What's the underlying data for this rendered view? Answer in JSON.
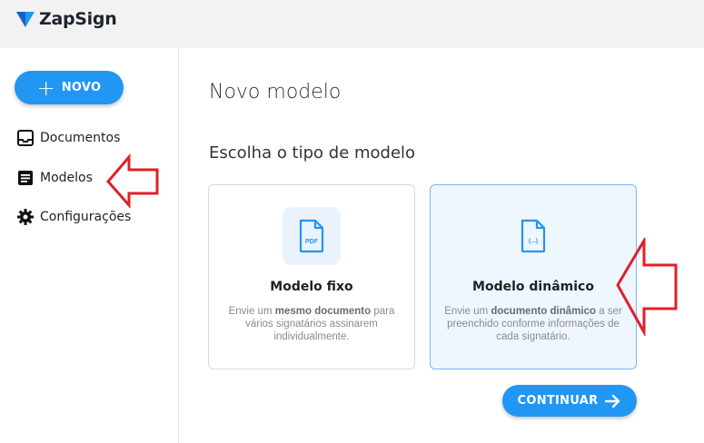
{
  "brand": {
    "name": "ZapSign",
    "accent": "#2196f3"
  },
  "sidebar": {
    "new_button": {
      "icon": "plus-icon",
      "label": "NOVO"
    },
    "items": [
      {
        "icon": "inbox-icon",
        "label": "Documentos"
      },
      {
        "icon": "template-icon",
        "label": "Modelos"
      },
      {
        "icon": "gear-icon",
        "label": "Configurações"
      }
    ]
  },
  "main": {
    "title": "Novo modelo",
    "subtitle": "Escolha o tipo de modelo",
    "cards": [
      {
        "icon": "pdf-file-icon",
        "icon_text": "PDF",
        "title": "Modelo fixo",
        "desc_pre": "Envie um ",
        "desc_bold": "mesmo documento",
        "desc_post": " para vários signatários assinarem individualmente.",
        "selected": false
      },
      {
        "icon": "dynamic-file-icon",
        "icon_text": "{...}",
        "title": "Modelo dinâmico",
        "desc_pre": "Envie um ",
        "desc_bold": "documento dinâmico",
        "desc_post": " a ser preenchido conforme informações de cada signatário.",
        "selected": true
      }
    ],
    "continue_button": {
      "label": "CONTINUAR",
      "icon": "arrow-right-icon"
    }
  },
  "annotation_color": "#e0202a"
}
